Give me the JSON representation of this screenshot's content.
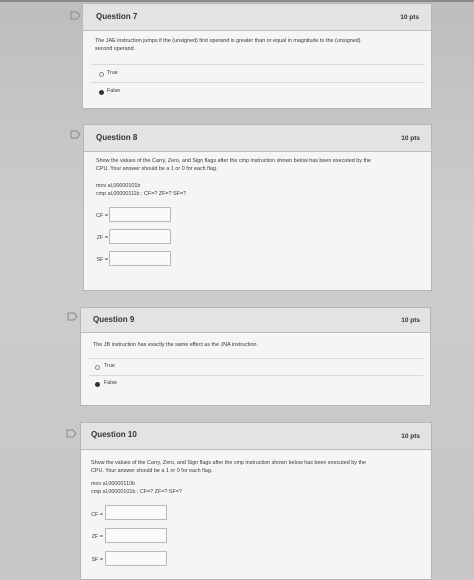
{
  "questions": [
    {
      "title": "Question 7",
      "points": "10 pts",
      "text_lines": [
        "The JAE instruction jumps if the (unsigned) first operand is greater than or equal in magnitude to the (unsigned)",
        "second operand."
      ],
      "answers": [
        {
          "label": "True",
          "selected": false
        },
        {
          "label": "False",
          "selected": true
        }
      ]
    },
    {
      "title": "Question 8",
      "points": "10 pts",
      "text_lines": [
        "Show the values of the Carry, Zero, and Sign flags after the cmp instruction shown below has been executed by the",
        "CPU. Your answer should be a 1 or 0 for each flag."
      ],
      "code_lines": [
        "mov al,00000101b",
        "cmp al,00000111b   ; CF=?  ZF=?  SF=?"
      ],
      "flags": [
        {
          "label": "CF =",
          "value": ""
        },
        {
          "label": "ZF =",
          "value": ""
        },
        {
          "label": "SF =",
          "value": ""
        }
      ]
    },
    {
      "title": "Question 9",
      "points": "10 pts",
      "text_lines": [
        "The JB instruction has exactly the same effect as the JNA instruction."
      ],
      "answers": [
        {
          "label": "True",
          "selected": false
        },
        {
          "label": "False",
          "selected": true
        }
      ]
    },
    {
      "title": "Question 10",
      "points": "10 pts",
      "text_lines": [
        "Show the values of the Carry, Zero, and Sign flags after the cmp instruction shown below has been executed by the",
        "CPU. Your answer should be a 1 or 0 for each flag."
      ],
      "code_lines": [
        "mov al,00000110b",
        "cmp al,00000101b   ; CF=?  ZF=?  SF=?"
      ],
      "flags": [
        {
          "label": "CF =",
          "value": ""
        },
        {
          "label": "ZF =",
          "value": ""
        },
        {
          "label": "SF =",
          "value": ""
        }
      ]
    }
  ],
  "colors": {
    "page_bg": "#c9c9c9",
    "card_bg": "#f5f5f5",
    "header_bg": "#e3e3e3",
    "flag_icon": "#8a8a8a"
  },
  "icons": {
    "question_flag": "bookmark-flag-icon",
    "radio_on": "radio-selected-icon",
    "radio_off": "radio-unselected-icon"
  }
}
